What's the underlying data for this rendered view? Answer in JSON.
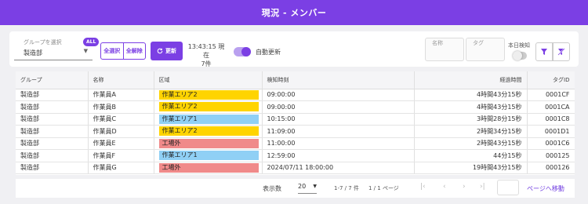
{
  "header": {
    "title": "現況 - メンバー"
  },
  "toolbar": {
    "group_label": "グループを選択",
    "group_value": "製造部",
    "all_badge": "ALL",
    "select_all": "全選択",
    "deselect_all": "全解除",
    "refresh": "更新",
    "current_time": "13:43:15 現在",
    "count": "7件",
    "auto_refresh_label": "自動更新",
    "auto_refresh_on": true,
    "name_label": "名称",
    "tag_label": "タグ",
    "today_label": "本日検知",
    "today_on": false,
    "accent_color": "#7b3fe4"
  },
  "table": {
    "columns": [
      "グループ",
      "名称",
      "区域",
      "検知時刻",
      "経過時間",
      "タグID"
    ],
    "rows": [
      {
        "group": "製造部",
        "name": "作業員A",
        "area": "作業エリア2",
        "area_color": "#ffd400",
        "time": "09:00:00",
        "elapsed": "4時間43分15秒",
        "tag": "0001CF"
      },
      {
        "group": "製造部",
        "name": "作業員B",
        "area": "作業エリア2",
        "area_color": "#ffd400",
        "time": "09:00:00",
        "elapsed": "4時間43分15秒",
        "tag": "0001CA"
      },
      {
        "group": "製造部",
        "name": "作業員C",
        "area": "作業エリア1",
        "area_color": "#90d0f5",
        "time": "10:15:00",
        "elapsed": "3時間28分15秒",
        "tag": "0001C8"
      },
      {
        "group": "製造部",
        "name": "作業員D",
        "area": "作業エリア2",
        "area_color": "#ffd400",
        "time": "11:09:00",
        "elapsed": "2時間34分15秒",
        "tag": "0001D1"
      },
      {
        "group": "製造部",
        "name": "作業員E",
        "area": "工場外",
        "area_color": "#f08a8a",
        "time": "11:00:00",
        "elapsed": "2時間43分15秒",
        "tag": "0001C6"
      },
      {
        "group": "製造部",
        "name": "作業員F",
        "area": "作業エリア1",
        "area_color": "#90d0f5",
        "time": "12:59:00",
        "elapsed": "44分15秒",
        "tag": "000125"
      },
      {
        "group": "製造部",
        "name": "作業員G",
        "area": "工場外",
        "area_color": "#f08a8a",
        "time": "2024/07/11 18:00:00",
        "elapsed": "19時間43分15秒",
        "tag": "000126"
      }
    ]
  },
  "pager": {
    "rows_label": "表示数",
    "page_size": "20",
    "range": "1-7 / 7 件",
    "page": "1 / 1 ページ",
    "goto_label": "ページへ移動"
  }
}
